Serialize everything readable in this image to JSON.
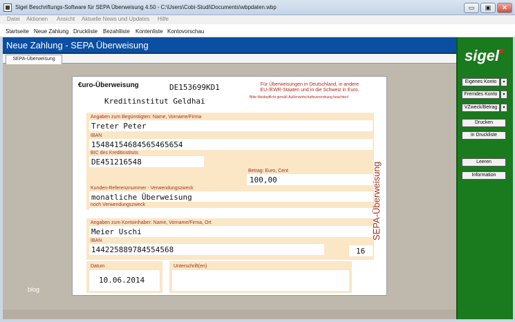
{
  "window": {
    "title": "Sigel Beschriftungs-Software für SEPA Überweisung 4.50 - C:\\Users\\Cobi-Studi\\Documents\\wbpdaten.wbp",
    "minimize": "▭",
    "maximize": "▣",
    "close": "✕"
  },
  "menu": [
    "Datei",
    "Aktionen",
    "Ansicht",
    "Aktuelle News und Updates",
    "Hilfe"
  ],
  "toolbar": [
    "Startseite",
    "Neue Zahlung",
    "Druckliste",
    "Bezahlliste",
    "Kontenliste",
    "Kontovorschau"
  ],
  "header": {
    "title": "Neue Zahlung - SEPA Überweisung"
  },
  "tab": {
    "label": "SEPA-Überweisung"
  },
  "sidebar": {
    "logo_text": "sigel",
    "buttons": {
      "eigenes_konto": "Eigenes Konto",
      "fremdes_konto": "Fremdes Konto",
      "vzweck": "VZweck/Betrag",
      "drucken": "Drucken",
      "in_druckliste": "in Druckliste",
      "leeren": "Leeren",
      "information": "Information"
    },
    "dropdown_arrow": "▾"
  },
  "footer": {
    "blog": "blog"
  },
  "form": {
    "heading": "€uro-Überweisung",
    "bic_top": "DE153699KD1",
    "bank_name": "Kreditinstitut Geldhai",
    "notice": [
      "Für Überweisungen in Deutschland, in andere",
      "EU-/EWR-Staaten und in die Schweiz in Euro."
    ],
    "notice_small": "Bitte Meldepflicht gemäß Außenwirtschaftsverordnung beachten!",
    "vertical_label": "SEPA-Überweisung",
    "beneficiary": {
      "label": "Angaben zum Begünstigten: Name, Vorname/Firma",
      "value": "Treter Peter"
    },
    "iban": {
      "label": "IBAN",
      "value": "15484154684565465654"
    },
    "bic": {
      "label": "BIC des Kreditinstituts",
      "value": "DE451216548"
    },
    "amount": {
      "label": "Betrag: Euro, Cent",
      "value": "100,00"
    },
    "reference": {
      "label": "Kunden-Referenznummer - Verwendungszweck",
      "value": "monatliche Überweisung"
    },
    "reference2": {
      "label": "noch Verwendungszweck",
      "value": ""
    },
    "payer": {
      "label": "Angaben zum Kontoinhaber: Name, Vorname/Firma, Ort",
      "value": "Meier Uschi"
    },
    "payer_iban": {
      "label": "IBAN",
      "value": "1442258897845545​68"
    },
    "code": "16",
    "date": {
      "label": "Datum",
      "value": "10.06.2014"
    },
    "signature": {
      "label": "Unterschrift(en)"
    }
  }
}
